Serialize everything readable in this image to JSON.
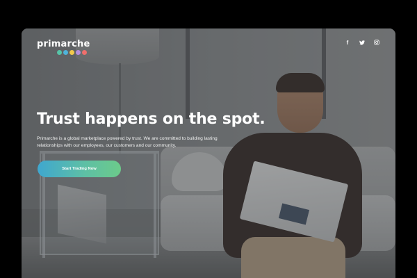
{
  "brand": {
    "name": "primarche",
    "dot_colors": [
      "#57c4a8",
      "#4fb3d9",
      "#f2c94c",
      "#b48ee0",
      "#ef6f6c"
    ]
  },
  "social": {
    "facebook": "f",
    "twitter": "t",
    "instagram": "◎"
  },
  "hero": {
    "headline": "Trust happens on the spot.",
    "subtext": "Primarche is a global marketplace powered by trust. We are committed to building lasting relationships with our employees, our customers and our community.",
    "cta_label": "Start Trading Now"
  },
  "colors": {
    "frame_bg": "#000000",
    "cta_gradient_start": "#3fa7cf",
    "cta_gradient_end": "#6ccb8a"
  }
}
